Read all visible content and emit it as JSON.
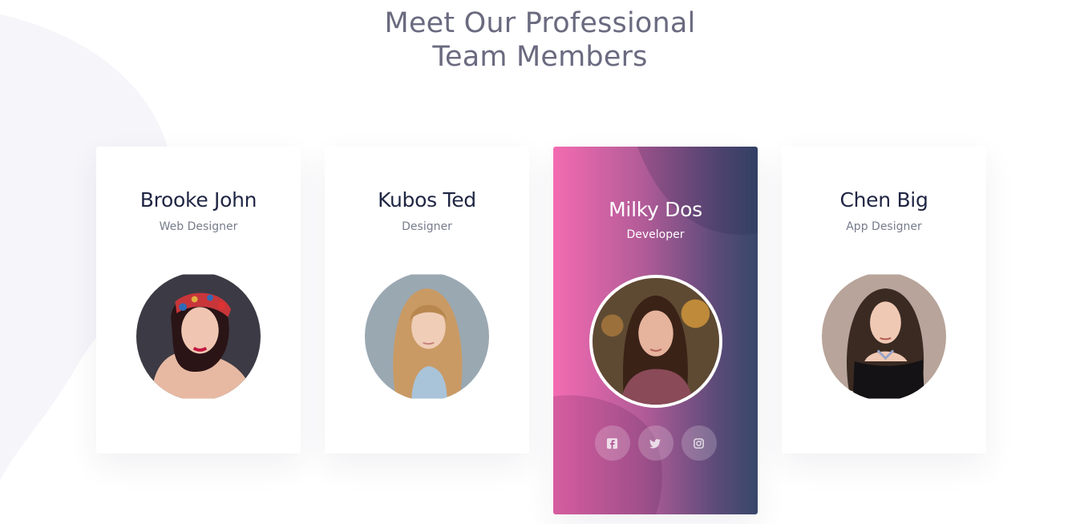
{
  "section": {
    "title_line1": "Meet Our Professional",
    "title_line2": "Team Members"
  },
  "colors": {
    "heading": "#6a6a80",
    "name": "#1f2543",
    "role": "#777c8c",
    "active_gradient_start": "#f46bb1",
    "active_gradient_end": "#37476a"
  },
  "members": [
    {
      "name": "Brooke John",
      "role": "Web Designer"
    },
    {
      "name": "Kubos Ted",
      "role": "Designer"
    },
    {
      "name": "Milky Dos",
      "role": "Developer"
    },
    {
      "name": "Chen Big",
      "role": "App Designer"
    }
  ],
  "socials": [
    {
      "icon": "facebook-icon"
    },
    {
      "icon": "twitter-icon"
    },
    {
      "icon": "instagram-icon"
    }
  ]
}
